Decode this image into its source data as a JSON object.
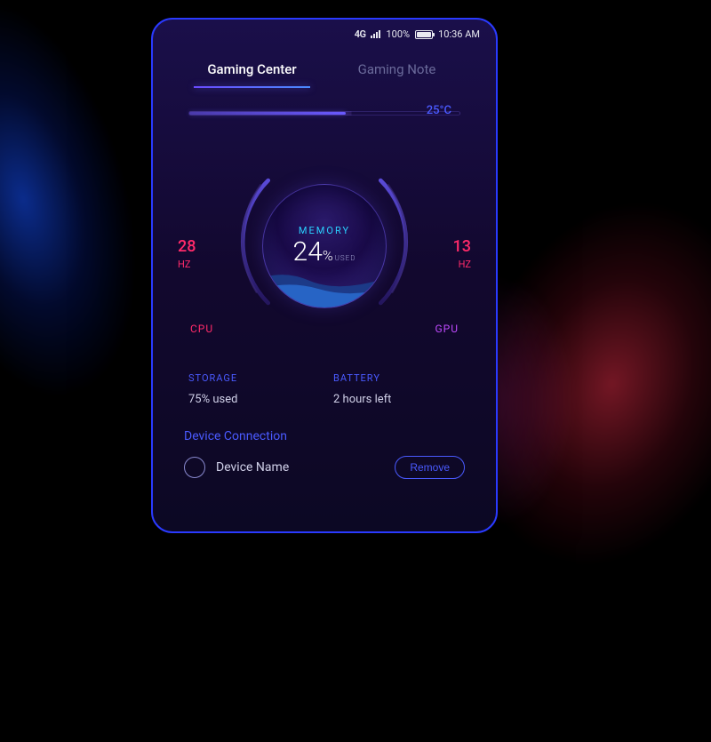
{
  "statusbar": {
    "network": "4G",
    "battery_pct": "100%",
    "time": "10:36 AM"
  },
  "tabs": {
    "active": "Gaming Center",
    "inactive": "Gaming Note"
  },
  "temperature": "25°C",
  "cpu": {
    "value": "28",
    "unit": "HZ",
    "label": "CPU"
  },
  "gpu": {
    "value": "13",
    "unit": "HZ",
    "label": "GPU"
  },
  "memory": {
    "label": "MEMORY",
    "value": "24",
    "pct": "%",
    "used": "USED"
  },
  "storage": {
    "label": "STORAGE",
    "value": "75% used"
  },
  "battery": {
    "label": "BATTERY",
    "value": "2 hours left"
  },
  "connection": {
    "title": "Device Connection",
    "device": "Device Name",
    "remove": "Remove"
  }
}
